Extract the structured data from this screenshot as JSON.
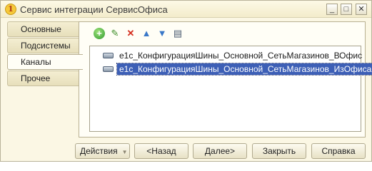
{
  "window": {
    "title": "Сервис интеграции СервисОфиса",
    "app_icon_glyph": "1",
    "controls": [
      {
        "name": "minimize-icon",
        "glyph": "_"
      },
      {
        "name": "restore-icon",
        "glyph": "□"
      },
      {
        "name": "close-icon",
        "glyph": "✕"
      }
    ]
  },
  "tabs": [
    {
      "label": "Основные",
      "active": false
    },
    {
      "label": "Подсистемы",
      "active": false
    },
    {
      "label": "Каналы",
      "active": true
    },
    {
      "label": "Прочее",
      "active": false
    }
  ],
  "toolbar": [
    {
      "name": "add-icon",
      "glyph": "+",
      "color": "#2f9a2f"
    },
    {
      "name": "edit-pencil-icon",
      "glyph": "✎",
      "color": "#3f8f2a"
    },
    {
      "name": "delete-icon",
      "glyph": "✕",
      "color": "#d42d1d"
    },
    {
      "name": "move-up-icon",
      "glyph": "▲",
      "color": "#3a78c8"
    },
    {
      "name": "move-down-icon",
      "glyph": "▼",
      "color": "#3a78c8"
    },
    {
      "name": "list-properties-icon",
      "glyph": "▤",
      "color": "#4a5a70"
    }
  ],
  "channels": [
    {
      "label": "e1c_КонфигурацияШины_Основной_СетьМагазинов_ВОфис",
      "selected": false
    },
    {
      "label": "e1c_КонфигурацияШины_Основной_СетьМагазинов_ИзОфиса",
      "selected": true
    }
  ],
  "buttons": {
    "actions": "Действия",
    "actions_arrow": "▼",
    "back": "<Назад",
    "next": "Далее>",
    "close": "Закрыть",
    "help": "Справка"
  }
}
